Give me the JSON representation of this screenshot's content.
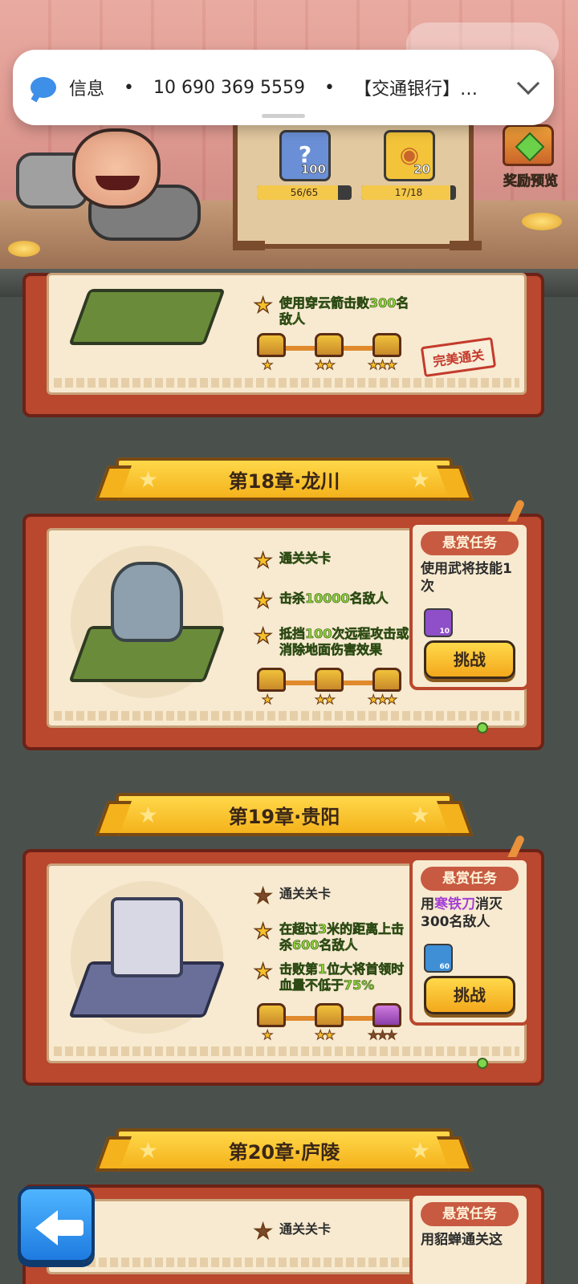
{
  "notification": {
    "app": "信息",
    "sender": "10 690 369 5559",
    "preview": "【交通银行】…"
  },
  "resources": [
    {
      "icon": "mystery-gem-icon",
      "count": "100",
      "progress": "56/65",
      "fill": 0.86
    },
    {
      "icon": "war-drum-icon",
      "count": "20",
      "progress": "17/18",
      "fill": 0.94
    }
  ],
  "reward_preview": {
    "label": "奖励预览"
  },
  "chapters": [
    {
      "objectives": [
        {
          "text": "使用穿云箭击败300名敌人",
          "done": true
        }
      ],
      "stamp": "完美通关"
    },
    {
      "title": "第18章·龙川",
      "objectives": [
        {
          "text": "通关关卡",
          "done": true
        },
        {
          "text": "击杀10000名敌人",
          "done": true
        },
        {
          "text": "抵挡100次远程攻击或消除地面伤害效果",
          "done": true
        }
      ],
      "bounty": {
        "header": "悬赏任务",
        "desc_pre": "使用武将技能1次",
        "desc_weapon": "",
        "desc_post": "",
        "item_count": "10",
        "button": "挑战"
      }
    },
    {
      "title": "第19章·贵阳",
      "objectives": [
        {
          "text": "通关关卡",
          "done": false
        },
        {
          "text": "在超过3米的距离上击杀600名敌人",
          "done": true
        },
        {
          "text": "击败第1位大将首领时血量不低于75%",
          "done": true
        }
      ],
      "bounty": {
        "header": "悬赏任务",
        "desc_pre": "用",
        "desc_weapon": "寒铁刀",
        "desc_post": "消灭300名敌人",
        "item_count": "60",
        "button": "挑战"
      }
    },
    {
      "title": "第20章·庐陵",
      "objectives": [
        {
          "text": "通关关卡",
          "done": false
        }
      ],
      "bounty": {
        "header": "悬赏任务",
        "desc_pre": "用貂蝉通关这",
        "desc_weapon": "",
        "desc_post": ""
      }
    }
  ],
  "colors": {
    "accent_gold": "#f4b21c",
    "frame_red": "#b9482e",
    "objective_green": "#8fd638",
    "weapon_purple": "#a53fd6"
  }
}
